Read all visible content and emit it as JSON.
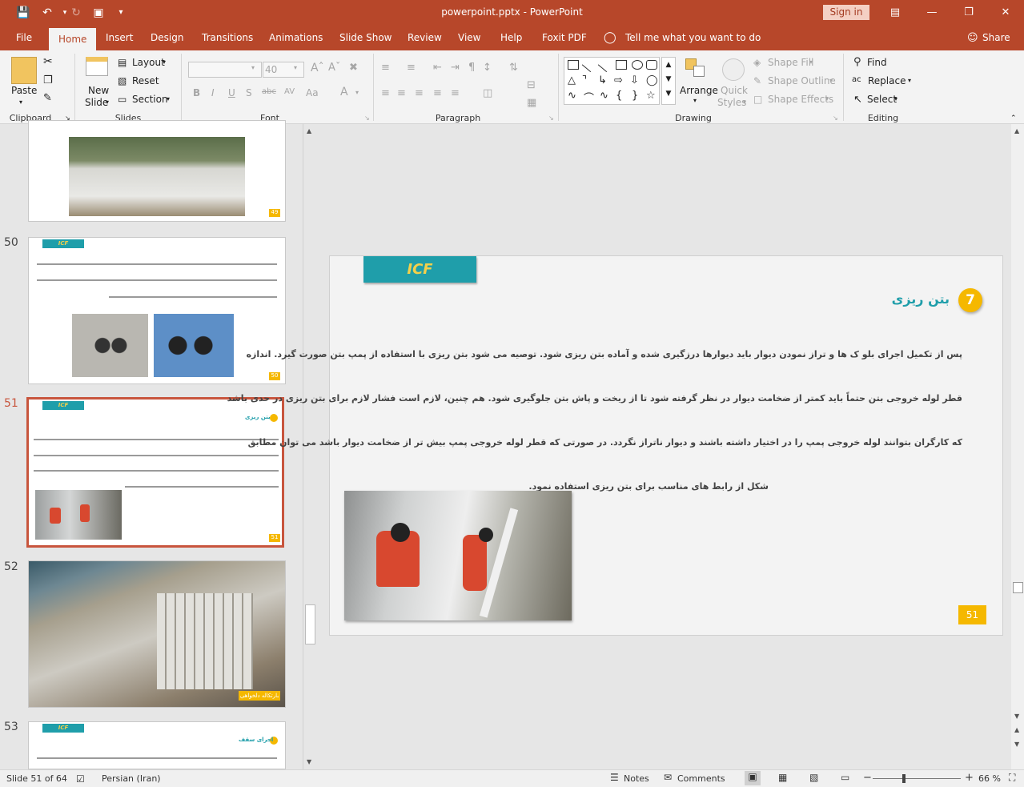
{
  "window": {
    "title": "powerpoint.pptx - PowerPoint",
    "signin": "Sign in"
  },
  "tabs": [
    "File",
    "Home",
    "Insert",
    "Design",
    "Transitions",
    "Animations",
    "Slide Show",
    "Review",
    "View",
    "Help",
    "Foxit PDF"
  ],
  "tell_me": "Tell me what you want to do",
  "share": "Share",
  "ribbon": {
    "clipboard": {
      "label": "Clipboard",
      "paste": "Paste"
    },
    "slides": {
      "label": "Slides",
      "new_slide_1": "New",
      "new_slide_2": "Slide",
      "layout": "Layout",
      "reset": "Reset",
      "section": "Section"
    },
    "font": {
      "label": "Font",
      "size": "40"
    },
    "paragraph": {
      "label": "Paragraph"
    },
    "drawing": {
      "label": "Drawing",
      "arrange": "Arrange",
      "quick_styles_1": "Quick",
      "quick_styles_2": "Styles",
      "shape_fill": "Shape Fill",
      "shape_outline": "Shape Outline",
      "shape_effects": "Shape Effects"
    },
    "editing": {
      "label": "Editing",
      "find": "Find",
      "replace": "Replace",
      "select": "Select"
    }
  },
  "thumbnails": {
    "n50": "50",
    "n51": "51",
    "n52": "52",
    "n53": "53",
    "badge": "ICF",
    "p49": "49",
    "p50": "50",
    "p51": "51",
    "t51": "بتن ریزی",
    "t53": "اجرای سقف",
    "n52_caption": "بارتکاله دلخواهی"
  },
  "slide": {
    "badge": "ICF",
    "number_circle": "7",
    "heading": "بتن ریزی",
    "paragraphs": [
      "پس از تکمیل اجرای بلو ک  ها و تراز نمودن دیوار باید دیوارها درزگیری شده و آماده بتن  ریزی شود. توصیه می شود بتن ریزی با استفاده از پمپ بتن صورت گیرد. اندازه",
      "قطر لوله خروجی بتن حتماً باید کمتر از ضخامت دیوار در نظر گرفته شود تا از ریخت و پاش بتن جلوگیری شود. هم چنین، لازم است فشار لازم برای بتن ریزی در حدی باشد",
      "که کارگران بتوانند لوله خروجی پمپ را در اختیار داشته باشند و دیوار ناتراز نگردد. در صورتی که قطر لوله خروجی پمپ بیش تر از ضخامت دیوار باشد می توان مطابق",
      "شکل از رابط های مناسب برای بتن ریزی استفاده نمود."
    ],
    "page_number": "51"
  },
  "status": {
    "slide_info": "Slide 51 of 64",
    "language": "Persian (Iran)",
    "notes": "Notes",
    "comments": "Comments",
    "zoom": "66 %"
  },
  "colors": {
    "accent": "#b7472a",
    "teal": "#1f9eaa",
    "yellow": "#f5b800"
  }
}
